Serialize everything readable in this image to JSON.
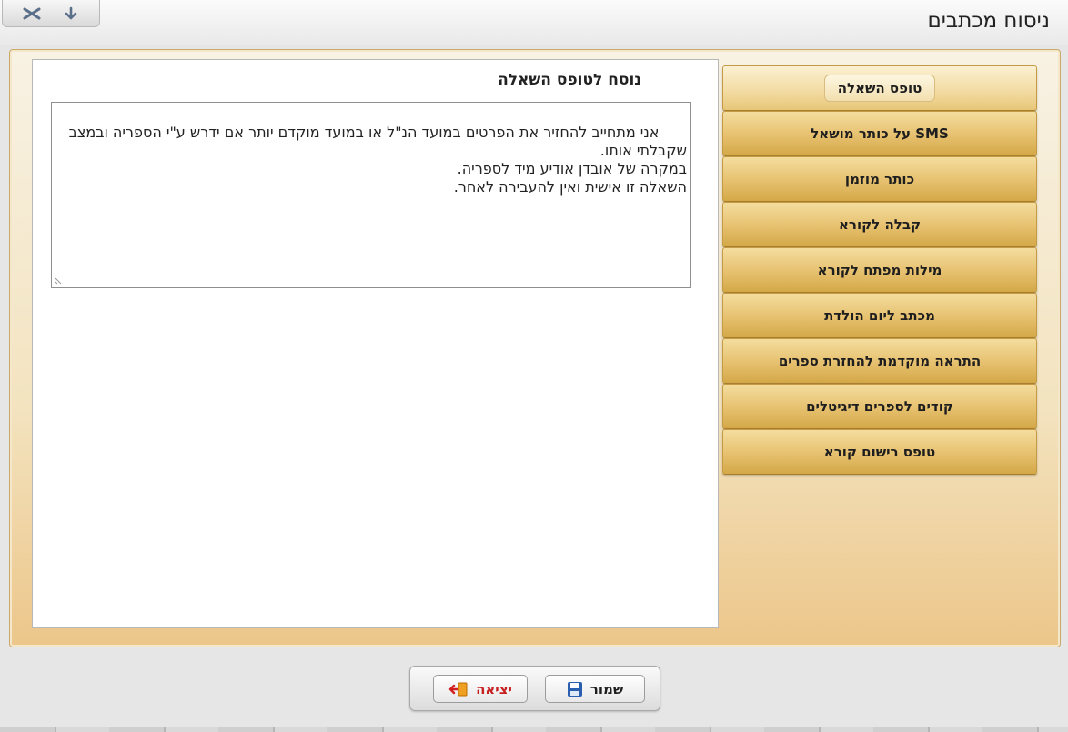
{
  "window": {
    "title": "ניסוח מכתבים"
  },
  "panel": {
    "title": "נוסח לטופס השאלה",
    "text": "אני מתחייב להחזיר את הפרטים במועד הנ\"ל או במועד מוקדם יותר אם ידרש ע\"י הספריה ובמצב שקבלתי אותו.\nבמקרה של אובדן אודיע מיד לספריה.\nהשאלה זו אישית ואין להעבירה לאחר."
  },
  "menu": {
    "items": [
      {
        "label": "טופס השאלה"
      },
      {
        "label": "SMS על כותר מושאל"
      },
      {
        "label": "כותר מוזמן"
      },
      {
        "label": "קבלה לקורא"
      },
      {
        "label": "מילות מפתח לקורא"
      },
      {
        "label": "מכתב ליום הולדת"
      },
      {
        "label": "התראה מוקדמת להחזרת ספרים"
      },
      {
        "label": "קודים לספרים דיגיטלים"
      },
      {
        "label": "טופס רישום קורא"
      }
    ]
  },
  "buttons": {
    "save": "שמור",
    "exit": "יציאה"
  },
  "colors": {
    "menu_gold": "#e6c06e",
    "exit_red": "#c62020",
    "save_icon_blue": "#2a5fb0"
  }
}
